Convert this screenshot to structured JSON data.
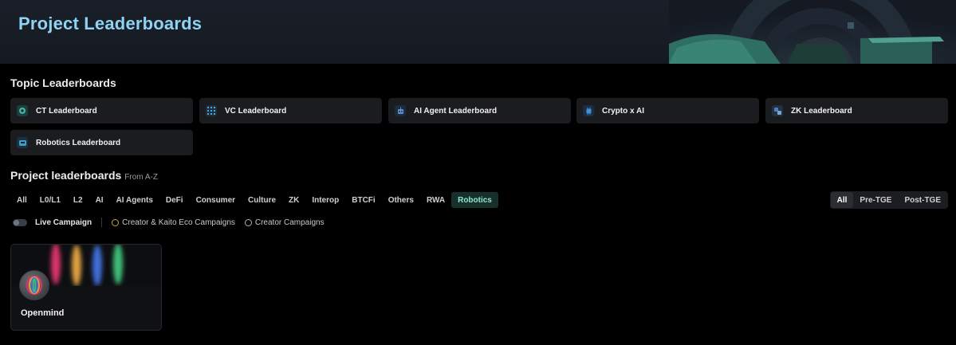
{
  "header": {
    "title": "Project Leaderboards"
  },
  "topics": {
    "title": "Topic Leaderboards",
    "items": [
      {
        "label": "CT Leaderboard",
        "icon": "ct-icon",
        "color": "#3fb6a8"
      },
      {
        "label": "VC Leaderboard",
        "icon": "vc-grid-icon",
        "color": "#4aa7d9"
      },
      {
        "label": "AI Agent Leaderboard",
        "icon": "robot-icon",
        "color": "#5b8fd6"
      },
      {
        "label": "Crypto x AI",
        "icon": "chip-icon",
        "color": "#3f8fd9"
      },
      {
        "label": "ZK Leaderboard",
        "icon": "zk-icon",
        "color": "#4e7fb8"
      },
      {
        "label": "Robotics Leaderboard",
        "icon": "robotics-icon",
        "color": "#3a9fd0"
      }
    ]
  },
  "projects": {
    "title": "Project leaderboards",
    "subtitle": "From A-Z",
    "categories": [
      "All",
      "L0/L1",
      "L2",
      "AI",
      "AI Agents",
      "DeFi",
      "Consumer",
      "Culture",
      "ZK",
      "Interop",
      "BTCFi",
      "Others",
      "RWA",
      "Robotics"
    ],
    "active_category": "Robotics",
    "stages": [
      "All",
      "Pre-TGE",
      "Post-TGE"
    ],
    "active_stage": "All",
    "live_campaign_label": "Live Campaign",
    "campaign_options": [
      "Creator & Kaito Eco Campaigns",
      "Creator Campaigns"
    ],
    "cards": [
      {
        "name": "Openmind"
      }
    ]
  },
  "colors": {
    "accent": "#8fd3f2",
    "active_chip_bg": "#17302c",
    "active_chip_text": "#8ee6cc"
  }
}
